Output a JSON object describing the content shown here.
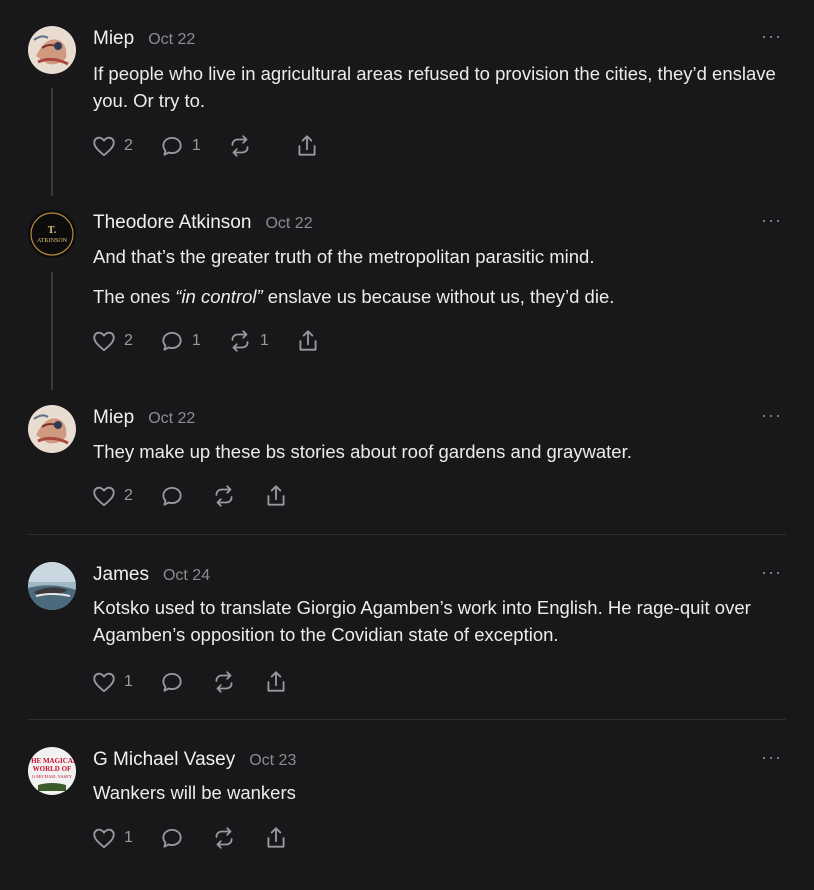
{
  "comments": [
    {
      "author": "Miep",
      "date": "Oct 22",
      "paragraphs": [
        "If people who live in agricultural areas refused to provision the cities, they’d enslave you. Or try to."
      ],
      "likes": "2",
      "replies": "1",
      "restacks": "",
      "avatar_icon": "avatar-miep"
    },
    {
      "author": "Theodore Atkinson",
      "date": "Oct 22",
      "para1": "And that’s the greater truth of the metropolitan parasitic mind.",
      "para2_before": "The ones ",
      "para2_em": "“in control”",
      "para2_after": " enslave us because without us, they’d die.",
      "likes": "2",
      "replies": "1",
      "restacks": "1",
      "avatar_text_top": "T.",
      "avatar_text_bottom": "ATKINSON"
    },
    {
      "author": "Miep",
      "date": "Oct 22",
      "paragraphs": [
        "They make up these bs stories about roof gardens and graywater."
      ],
      "likes": "2",
      "replies": "",
      "restacks": ""
    },
    {
      "author": "James",
      "date": "Oct 24",
      "paragraphs": [
        "Kotsko used to translate Giorgio Agamben’s work into English. He rage-quit over Agamben’s opposition to the Covidian state of exception."
      ],
      "likes": "1",
      "replies": "",
      "restacks": ""
    },
    {
      "author": "G Michael Vasey",
      "date": "Oct 23",
      "paragraphs": [
        "Wankers will be wankers"
      ],
      "likes": "1",
      "replies": "",
      "restacks": "",
      "avatar_text_1": "THE MAGICAL",
      "avatar_text_2": "WORLD OF",
      "avatar_text_3": "G MICHAEL VASEY"
    }
  ],
  "more_label": "···",
  "colors": {
    "background": "#18181a",
    "text": "#ececec",
    "muted": "#8c8c90",
    "divider": "#2e2e31"
  }
}
